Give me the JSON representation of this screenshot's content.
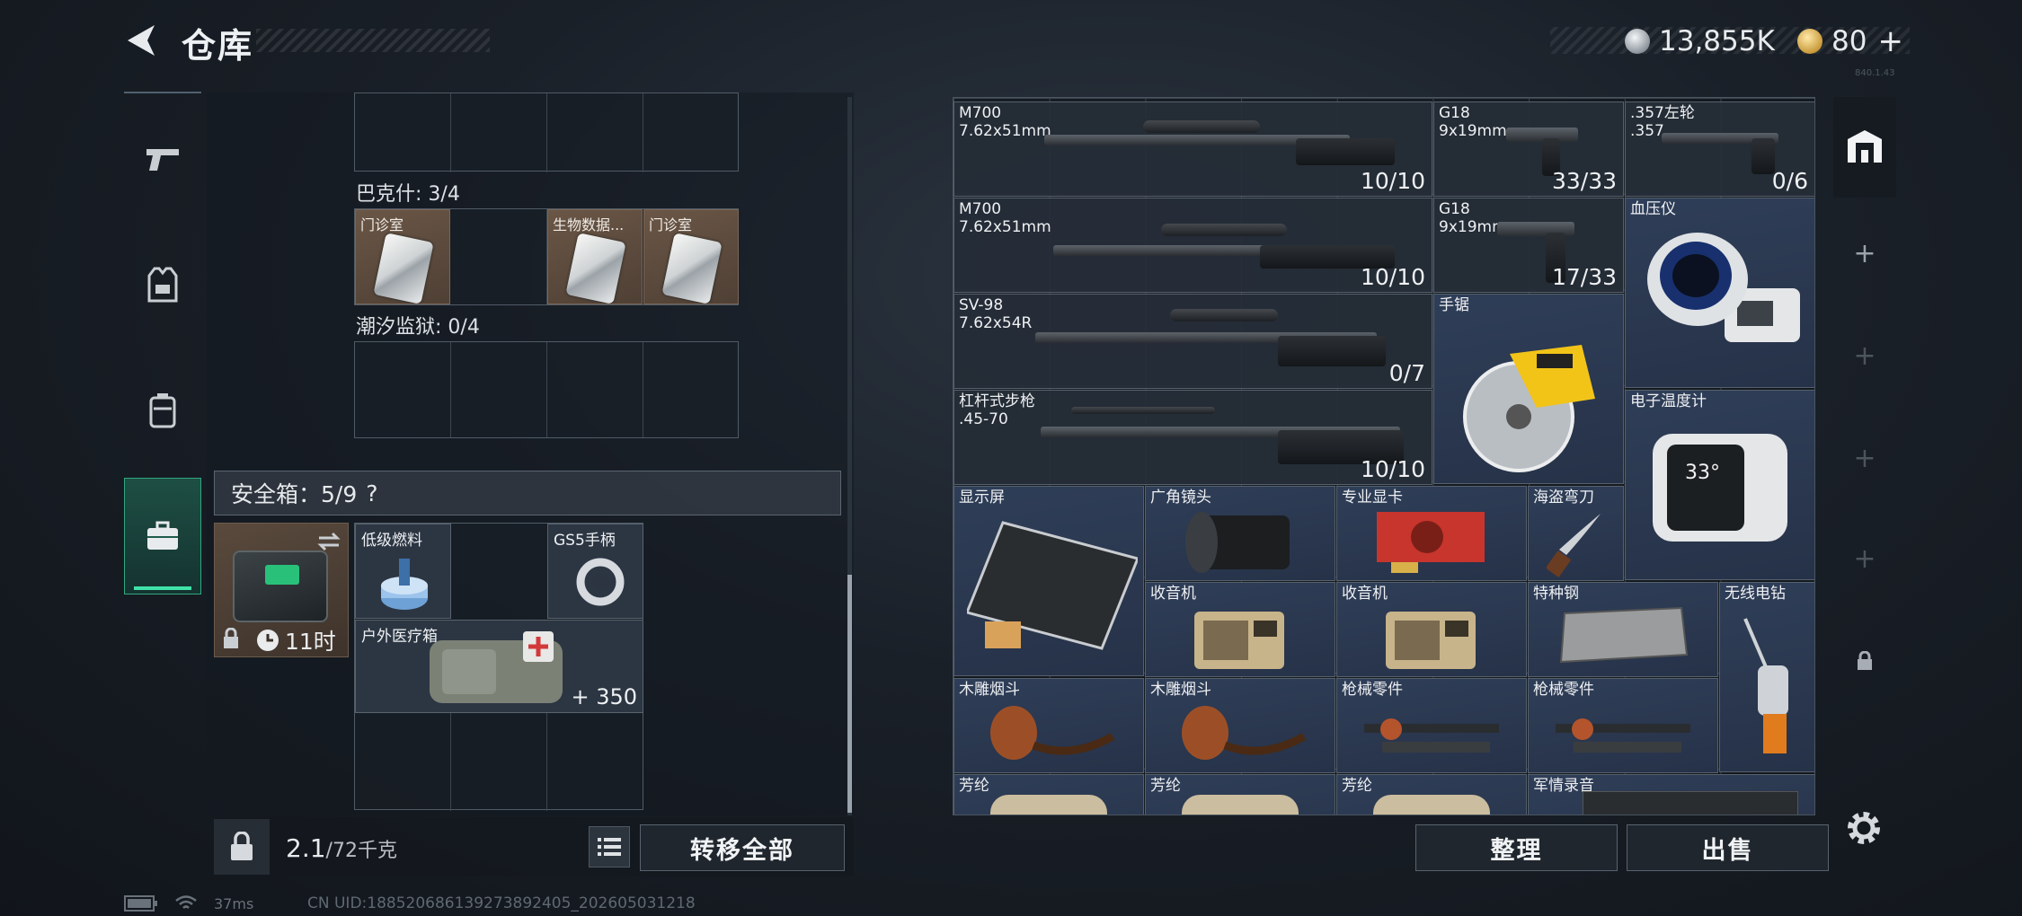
{
  "header": {
    "title": "仓库",
    "silver_amount": "13,855K",
    "gold_amount": "80",
    "gold_plus": "+",
    "version": "840.1.43"
  },
  "left": {
    "groups": [
      {
        "label": "巴克什: 3/4",
        "items": [
          "门诊室",
          "",
          "生物数据...",
          "门诊室"
        ]
      },
      {
        "label": "潮汐监狱: 0/4"
      }
    ],
    "safe_header": "安全箱：5/9",
    "safe_help": "?",
    "safe_timer": "11时",
    "safe_items": [
      {
        "label": "低级燃料"
      },
      {
        "label": "GS5手柄"
      },
      {
        "label": "户外医疗箱",
        "count": "+ 350"
      }
    ],
    "weight_value": "2.1",
    "weight_max": "/72千克",
    "transfer_all": "转移全部"
  },
  "stash": {
    "items": [
      {
        "label": "M700\n7.62x51mm",
        "count": "10/10"
      },
      {
        "label": "G18\n9x19mm",
        "count": "33/33"
      },
      {
        "label": ".357左轮\n.357",
        "count": "0/6"
      },
      {
        "label": "M700\n7.62x51mm",
        "count": "10/10"
      },
      {
        "label": "G18\n9x19mm",
        "count": "17/33"
      },
      {
        "label": "血压仪"
      },
      {
        "label": "SV-98\n7.62x54R",
        "count": "0/7"
      },
      {
        "label": "手锯"
      },
      {
        "label": "杠杆式步枪\n.45-70",
        "count": "10/10"
      },
      {
        "label": "电子温度计",
        "display": "33°"
      },
      {
        "label": "显示屏"
      },
      {
        "label": "广角镜头"
      },
      {
        "label": "专业显卡"
      },
      {
        "label": "海盗弯刀"
      },
      {
        "label": "收音机"
      },
      {
        "label": "收音机"
      },
      {
        "label": "特种钢"
      },
      {
        "label": "无线电钻"
      },
      {
        "label": "木雕烟斗"
      },
      {
        "label": "木雕烟斗"
      },
      {
        "label": "枪械零件"
      },
      {
        "label": "枪械零件"
      },
      {
        "label": "芳纶"
      },
      {
        "label": "芳纶"
      },
      {
        "label": "芳纶"
      },
      {
        "label": "军情录音"
      }
    ],
    "sort_label": "整理",
    "sell_label": "出售"
  },
  "status": {
    "ping": "37ms",
    "uid": "CN UID:188520686139273892405_202605031218"
  }
}
